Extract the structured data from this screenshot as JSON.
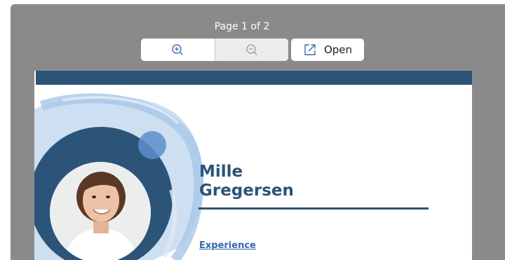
{
  "viewer": {
    "page_indicator": "Page 1 of 2",
    "toolbar": {
      "zoom_in_icon": "zoom-in-icon",
      "zoom_out_icon": "zoom-out-icon",
      "open_icon": "external-link-icon",
      "open_label": "Open"
    }
  },
  "document": {
    "name_first": "Mille",
    "name_last": "Gregersen",
    "section_heading": "Experience"
  },
  "colors": {
    "viewer_background": "#8a8a8a",
    "doc_primary": "#2c5479",
    "doc_accent_light": "#a9c7e8",
    "link_blue": "#3467a8"
  }
}
